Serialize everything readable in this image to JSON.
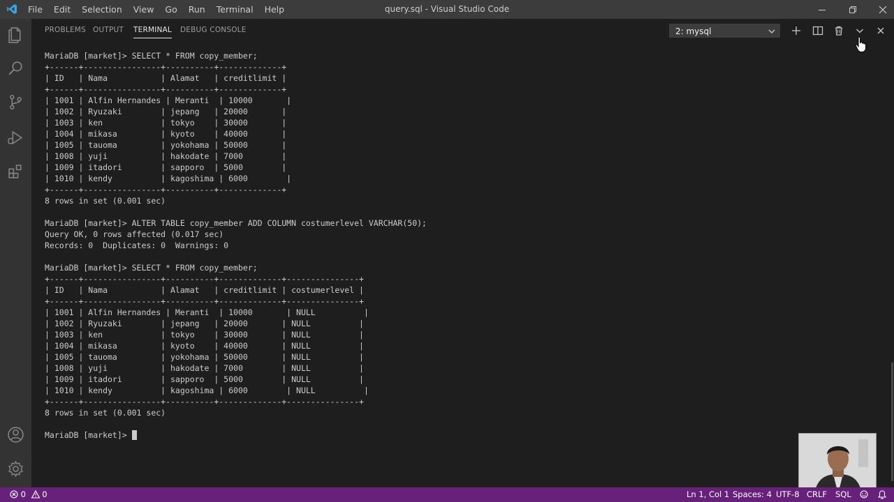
{
  "window": {
    "title": "query.sql - Visual Studio Code",
    "menu": [
      "File",
      "Edit",
      "Selection",
      "View",
      "Go",
      "Run",
      "Terminal",
      "Help"
    ]
  },
  "activity_bar": {
    "icons": [
      "files-icon",
      "search-icon",
      "source-control-icon",
      "run-debug-icon",
      "extensions-icon",
      "account-icon",
      "settings-gear-icon"
    ]
  },
  "panel": {
    "tabs": [
      "PROBLEMS",
      "OUTPUT",
      "TERMINAL",
      "DEBUG CONSOLE"
    ],
    "active_tab": "TERMINAL",
    "terminal_select": "2: mysql"
  },
  "terminal": {
    "lines": [
      "MariaDB [market]> SELECT * FROM copy_member;",
      "+------+----------------+----------+-------------+",
      "| ID   | Nama           | Alamat   | creditlimit |",
      "+------+----------------+----------+-------------+",
      "| 1001 | Alfin Hernandes | Meranti  | 10000       |",
      "| 1002 | Ryuzaki        | jepang   | 20000       |",
      "| 1003 | ken            | tokyo    | 30000       |",
      "| 1004 | mikasa         | kyoto    | 40000       |",
      "| 1005 | tauoma         | yokohama | 50000       |",
      "| 1008 | yuji           | hakodate | 7000        |",
      "| 1009 | itadori        | sapporo  | 5000        |",
      "| 1010 | kendy          | kagoshima | 6000        |",
      "+------+----------------+----------+-------------+",
      "8 rows in set (0.001 sec)",
      "",
      "MariaDB [market]> ALTER TABLE copy_member ADD COLUMN costumerlevel VARCHAR(50);",
      "Query OK, 0 rows affected (0.017 sec)",
      "Records: 0  Duplicates: 0  Warnings: 0",
      "",
      "MariaDB [market]> SELECT * FROM copy_member;",
      "+------+----------------+----------+-------------+---------------+",
      "| ID   | Nama           | Alamat   | creditlimit | costumerlevel |",
      "+------+----------------+----------+-------------+---------------+",
      "| 1001 | Alfin Hernandes | Meranti  | 10000       | NULL          |",
      "| 1002 | Ryuzaki        | jepang   | 20000       | NULL          |",
      "| 1003 | ken            | tokyo    | 30000       | NULL          |",
      "| 1004 | mikasa         | kyoto    | 40000       | NULL          |",
      "| 1005 | tauoma         | yokohama | 50000       | NULL          |",
      "| 1008 | yuji           | hakodate | 7000        | NULL          |",
      "| 1009 | itadori        | sapporo  | 5000        | NULL          |",
      "| 1010 | kendy          | kagoshima | 6000        | NULL          |",
      "+------+----------------+----------+-------------+---------------+",
      "8 rows in set (0.001 sec)",
      ""
    ],
    "prompt": "MariaDB [market]> "
  },
  "status_bar": {
    "errors": "0",
    "warnings": "0",
    "position": "Ln 1, Col 1",
    "spaces": "Spaces: 4",
    "encoding": "UTF-8",
    "eol": "CRLF",
    "language": "SQL"
  },
  "colors": {
    "status_bar": "#68217a",
    "title_bar": "#3c3c3c",
    "activity_bar": "#333333",
    "background": "#1e1e1e",
    "vscode_blue": "#3ba7e5"
  }
}
